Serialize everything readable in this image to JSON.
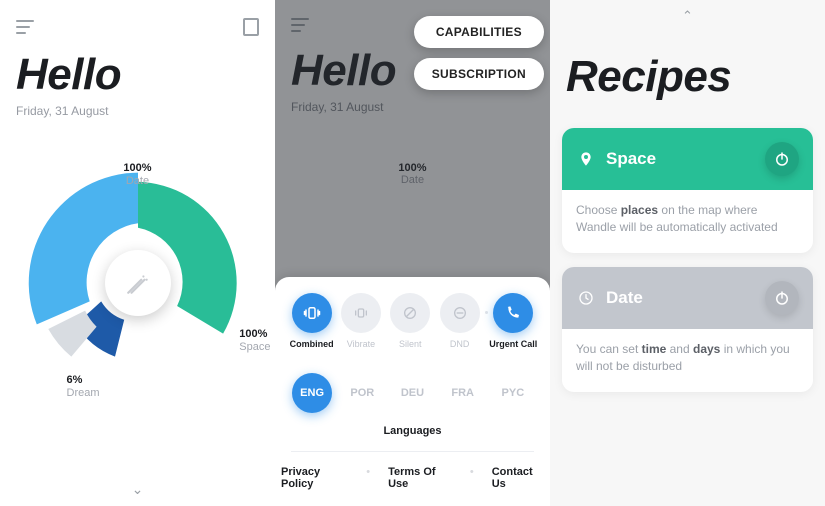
{
  "panel1": {
    "title": "Hello",
    "date": "Friday, 31 August",
    "chart": {
      "date": {
        "pct": "100%",
        "name": "Date"
      },
      "space": {
        "pct": "100%",
        "name": "Space"
      },
      "dream": {
        "pct": "6%",
        "name": "Dream"
      }
    }
  },
  "panel2": {
    "title": "Hello",
    "date": "Friday, 31 August",
    "chart_label": {
      "pct": "100%",
      "name": "Date"
    },
    "dropdown": {
      "capabilities": "CAPABILITIES",
      "subscription": "SUBSCRIPTION"
    },
    "modes": {
      "combined": "Combined",
      "vibrate": "Vibrate",
      "silent": "Silent",
      "dnd": "DND",
      "urgent": "Urgent Call"
    },
    "languages": {
      "title": "Languages",
      "eng": "ENG",
      "por": "POR",
      "deu": "DEU",
      "fra": "FRA",
      "pyc": "PYC"
    },
    "footer": {
      "privacy": "Privacy Policy",
      "terms": "Terms Of Use",
      "contact": "Contact Us"
    }
  },
  "panel3": {
    "title": "Recipes",
    "space": {
      "title": "Space",
      "desc_pre": "Choose ",
      "desc_bold": "places",
      "desc_post": " on the map where Wandle will be automatically activated"
    },
    "date": {
      "title": "Date",
      "desc_pre": "You can set ",
      "desc_b1": "time",
      "desc_mid": " and ",
      "desc_b2": "days",
      "desc_post": " in which you will not be disturbed"
    }
  },
  "chart_data": {
    "type": "pie",
    "title": "",
    "series": [
      {
        "name": "Date",
        "value": 100,
        "color": "#4bb3ef"
      },
      {
        "name": "Space",
        "value": 100,
        "color": "#29bd97"
      },
      {
        "name": "Dream",
        "value": 6,
        "color": "#1e5aa8"
      }
    ]
  }
}
